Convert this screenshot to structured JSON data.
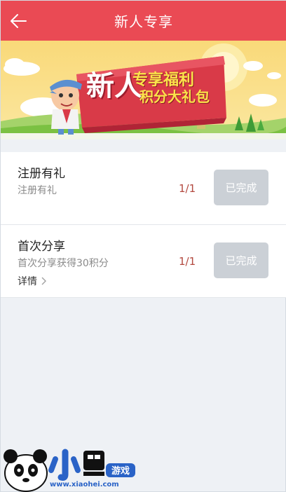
{
  "header": {
    "title": "新人专享",
    "back_icon": "arrow-left-icon"
  },
  "banner": {
    "big_text": "新人",
    "subtitle_1": "专享福利",
    "subtitle_2": "积分大礼包"
  },
  "tasks": [
    {
      "name": "注册有礼",
      "desc": "注册有礼",
      "count": "1/1",
      "button": "已完成"
    },
    {
      "name": "首次分享",
      "desc": "首次分享获得30积分",
      "count": "1/1",
      "button": "已完成",
      "detail": "详情"
    }
  ],
  "watermark": {
    "brand": "小黑游戏",
    "url": "www.xiaohei.com"
  },
  "colors": {
    "header_bg": "#ea4a54",
    "button_done_bg": "#cbd0d6",
    "count_color": "#b3493f"
  }
}
